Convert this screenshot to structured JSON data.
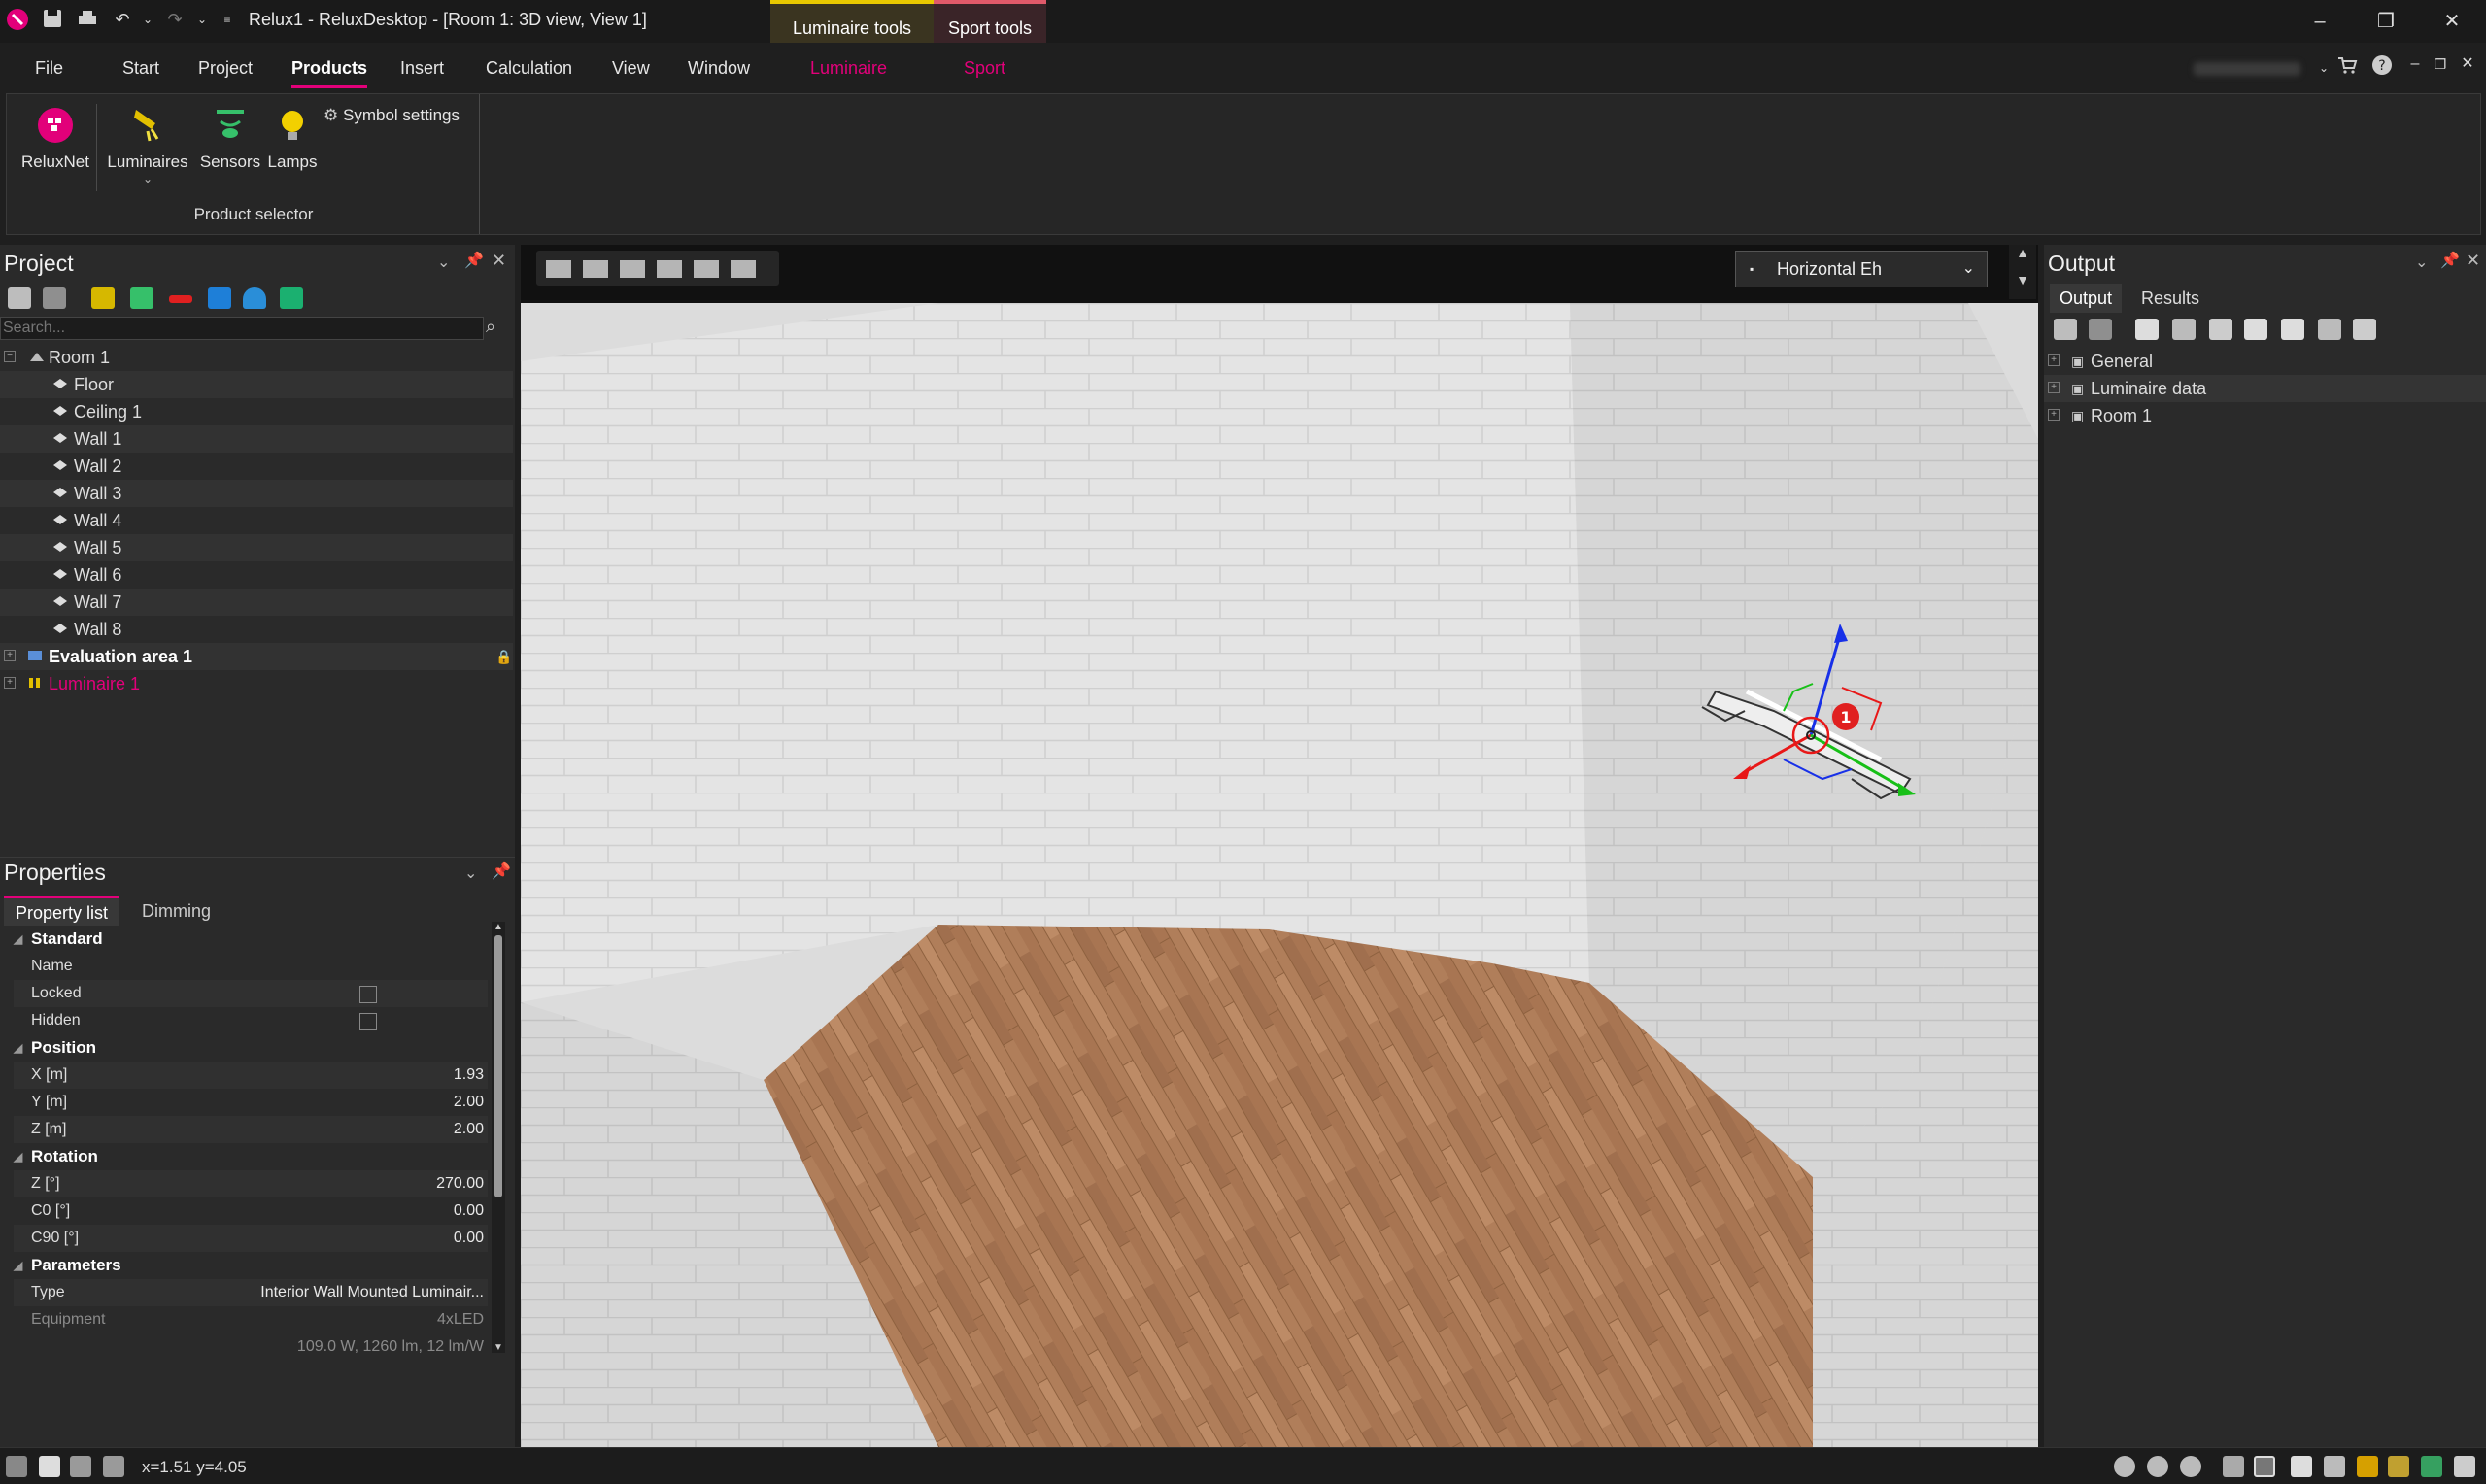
{
  "window": {
    "app_title": "Relux1 - ReluxDesktop - [Room 1: 3D view, View 1]",
    "context_tabs": [
      "Luminaire tools",
      "Sport tools"
    ],
    "controls": {
      "minimize": "–",
      "restore": "❐",
      "close": "✕"
    }
  },
  "menu": {
    "items": [
      "File",
      "Start",
      "Project",
      "Products",
      "Insert",
      "Calculation",
      "View",
      "Window",
      "Luminaire",
      "Sport"
    ],
    "active": "Products",
    "accent": "#e2007a"
  },
  "ribbon": {
    "buttons": [
      {
        "label": "ReluxNet",
        "icon": "reluxnet-icon"
      },
      {
        "label": "Luminaires",
        "icon": "luminaires-icon"
      },
      {
        "label": "Sensors",
        "icon": "sensors-icon"
      },
      {
        "label": "Lamps",
        "icon": "lamp-icon"
      }
    ],
    "symbol_settings": "Symbol settings",
    "group_label": "Product selector"
  },
  "project": {
    "title": "Project",
    "search_placeholder": "Search...",
    "tree": [
      {
        "label": "Room 1",
        "level": 0
      },
      {
        "label": "Floor",
        "level": 1
      },
      {
        "label": "Ceiling 1",
        "level": 1
      },
      {
        "label": "Wall 1",
        "level": 1
      },
      {
        "label": "Wall 2",
        "level": 1
      },
      {
        "label": "Wall 3",
        "level": 1
      },
      {
        "label": "Wall 4",
        "level": 1
      },
      {
        "label": "Wall 5",
        "level": 1
      },
      {
        "label": "Wall 6",
        "level": 1
      },
      {
        "label": "Wall 7",
        "level": 1
      },
      {
        "label": "Wall 8",
        "level": 1
      },
      {
        "label": "Evaluation area 1",
        "level": 0,
        "bold": true
      },
      {
        "label": "Luminaire 1",
        "level": 0,
        "color": "#e2007a"
      }
    ]
  },
  "properties": {
    "title": "Properties",
    "tabs": [
      "Property list",
      "Dimming"
    ],
    "standard": {
      "header": "Standard",
      "name": "Name",
      "locked": "Locked",
      "hidden": "Hidden"
    },
    "position": {
      "header": "Position",
      "x_label": "X [m]",
      "x": "1.93",
      "y_label": "Y [m]",
      "y": "2.00",
      "z_label": "Z [m]",
      "z": "2.00"
    },
    "rotation": {
      "header": "Rotation",
      "z_label": "Z [°]",
      "z": "270.00",
      "c0_label": "C0 [°]",
      "c0": "0.00",
      "c90_label": "C90 [°]",
      "c90": "0.00"
    },
    "parameters": {
      "header": "Parameters",
      "type_label": "Type",
      "type": "Interior Wall Mounted Luminair...",
      "equipment_label": "Equipment",
      "equipment": "4xLED",
      "power": "109.0 W, 1260 lm, 12 lm/W"
    }
  },
  "viewport": {
    "eval_mode": "Horizontal Eh",
    "marker": "1"
  },
  "output": {
    "title": "Output",
    "tabs": [
      "Output",
      "Results"
    ],
    "tree": [
      "General",
      "Luminaire data",
      "Room 1"
    ]
  },
  "status": {
    "coords": "x=1.51 y=4.05"
  }
}
